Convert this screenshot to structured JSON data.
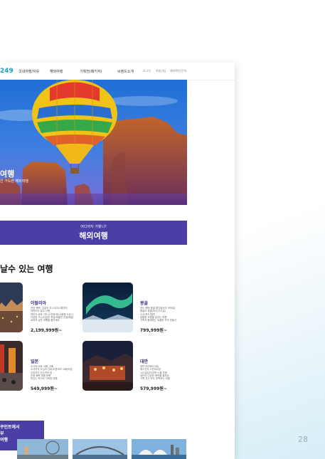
{
  "nav": {
    "logo": "249",
    "items": [
      "국내여행/자유",
      "해외여행",
      "기획전(패키지)",
      "브랜드소개"
    ],
    "utils": [
      "로그인",
      "회원가입",
      "예약확인/문의"
    ]
  },
  "hero": {
    "title": "여행",
    "subtitle": "간 가득한 해외여행"
  },
  "banner": {
    "small": "어디까지 가봤니?",
    "big": "해외여행"
  },
  "section": {
    "title": "날수 있는 여행"
  },
  "cards": [
    {
      "name": "이탈리아",
      "desc": [
        "관광 혜택: 주말의 자 2022/2월까지",
        "어떤아무 일주 사항",
        "박미의 로마 가드시/전북/제시/봉래 사뮤니",
        "다양한 구시/다양한 포장/박물관 관광/해설",
        "로마의 낭만 여행을 즐기세요"
      ],
      "price": "2,199,999원~"
    },
    {
      "name": "몽골",
      "desc": [
        "관도 혜택 몽골 할인에서의 3박4일",
        "몽골의 특별(하나/고도일)",
        "나고/푸드/첨판",
        "광활한 초원을 달리는 여행",
        "가족과 함께하는 특별한 추억 만들기"
      ],
      "price": "799,999원~"
    },
    {
      "name": "일본",
      "desc": [
        "오사카/교토 고베_고베",
        "오사카의 도심과 난바/도톤보리 고베/야경",
        "주방자가 오사카의 밤",
        "관광 혜택 체험 포함",
        "맛있는 먹거리 가득한 여행"
      ],
      "price": "549,999원~"
    },
    {
      "name": "대만",
      "desc": [
        "대만 타이베이 6일",
        "예스진지 스린야시장",
        "101빌딩/지우펀 노을 포함",
        "대만의 다양한 매력을 즐겨요",
        "가족 친구 모두 만족하는 여행"
      ],
      "price": "579,999원~"
    }
  ],
  "promo": {
    "lines": [
      "쿠인트에서",
      "부",
      "여행"
    ]
  },
  "page_number": "28",
  "colors": {
    "accent": "#4b3ea4",
    "logo": "#1a9cc4"
  }
}
